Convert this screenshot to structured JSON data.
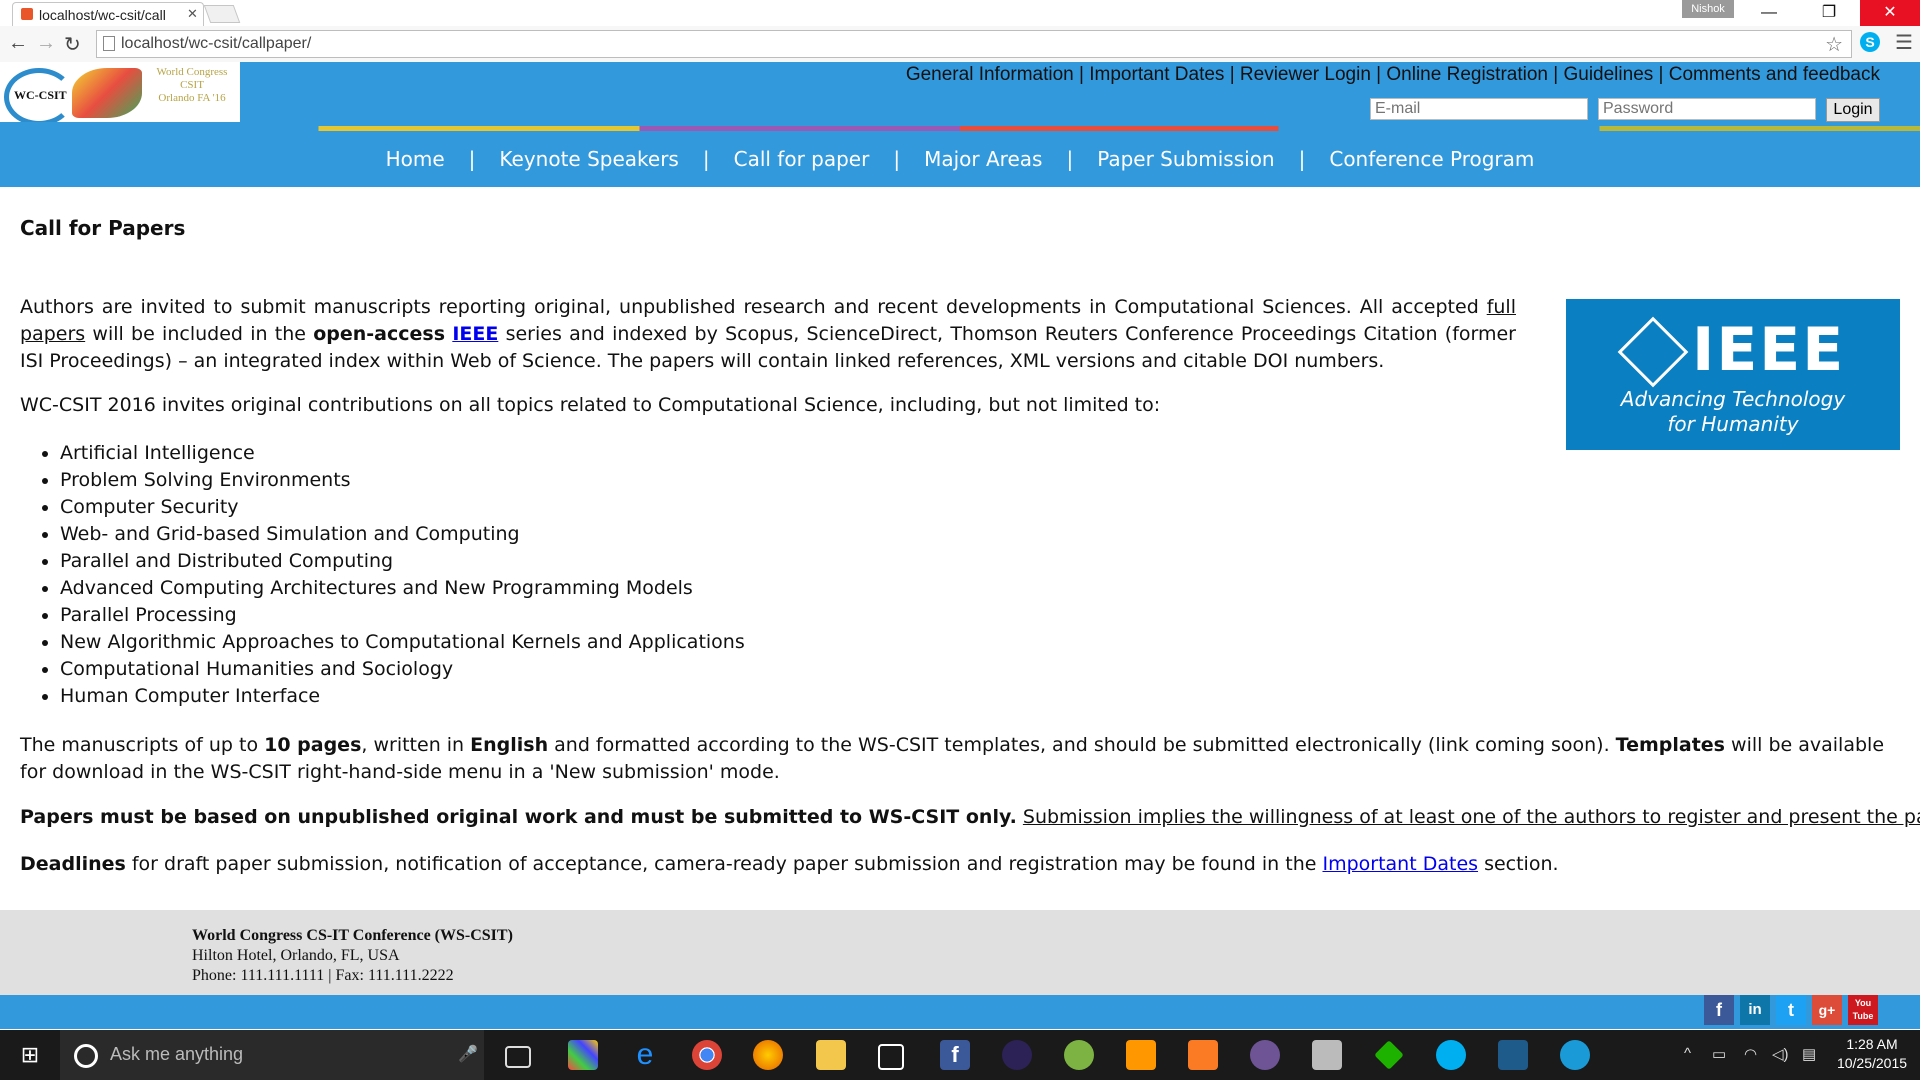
{
  "browser": {
    "tab_title": "localhost/wc-csit/call",
    "tab_close": "✕",
    "profile_name": "Nishok",
    "url": "localhost/wc-csit/callpaper/"
  },
  "site": {
    "logo": {
      "abbr": "WC-CSIT",
      "line1": "World Congress",
      "line2": "CSIT",
      "line3": "Orlando FA '16"
    },
    "top_links": [
      "General Information",
      "Important Dates",
      "Reviewer Login",
      "Online Registration",
      "Guidelines",
      "Comments and feedback"
    ],
    "separator": "|",
    "email_placeholder": "E-mail",
    "password_placeholder": "Password",
    "login_label": "Login",
    "nav": [
      "Home",
      "Keynote Speakers",
      "Call for paper",
      "Major Areas",
      "Paper Submission",
      "Conference Program"
    ]
  },
  "content": {
    "title": "Call for Papers",
    "intro": {
      "p1": "Authors are invited to submit manuscripts reporting original, unpublished research and recent developments in Computational Sciences. All accepted ",
      "full_papers": "full papers",
      "p2": " will be included in the ",
      "open_access": "open-access",
      "ieee_link": "IEEE",
      "p3": " series and indexed by Scopus, ScienceDirect, Thomson Reuters Conference Proceedings Citation (former ISI Proceedings) – an integrated index within Web of Science. The papers will contain linked references, XML versions and citable DOI numbers."
    },
    "ieee_logo": {
      "word": "IEEE",
      "tagline1": "Advancing Technology",
      "tagline2": "for Humanity"
    },
    "topics_intro": "WC-CSIT 2016 invites original contributions on all topics related to Computational Science, including, but not limited to:",
    "topics": [
      "Artificial Intelligence",
      "Problem Solving Environments",
      "Computer Security",
      "Web- and Grid-based Simulation and Computing",
      "Parallel and Distributed Computing",
      "Advanced Computing Architectures and New Programming Models",
      "Parallel Processing",
      "New Algorithmic Approaches to Computational Kernels and Applications",
      "Computational Humanities and Sociology",
      "Human Computer Interface"
    ],
    "manuscripts": {
      "a": "The manuscripts of up to ",
      "pages": "10 pages",
      "b": ", written in ",
      "english": "English",
      "c": " and formatted according to the WS-CSIT templates, and should be submitted electronically (link coming soon). ",
      "templates": "Templates",
      "d": " will be available for download in the WS-CSIT right-hand-side menu in a 'New submission' mode."
    },
    "papers_must_bold": "Papers must be based on unpublished original work and must be submitted to WS-CSIT only.",
    "papers_must_underline": "Submission implies the willingness of at least one of the authors to register and present the paper.",
    "deadlines": {
      "bold": "Deadlines",
      "text": " for draft paper submission, notification of acceptance, camera-ready paper submission and registration may be found in the ",
      "link": "Important Dates",
      "end": " section."
    }
  },
  "footer": {
    "org": "World Congress CS-IT Conference (WS-CSIT)",
    "address": "Hilton Hotel, Orlando, FL, USA",
    "phone": "Phone: 111.111.1111 | Fax: 111.111.2222"
  },
  "social": [
    "f",
    "in",
    "t",
    "g+",
    "You Tube"
  ],
  "taskbar": {
    "search_placeholder": "Ask me anything",
    "time": "1:28 AM",
    "date": "10/25/2015"
  }
}
